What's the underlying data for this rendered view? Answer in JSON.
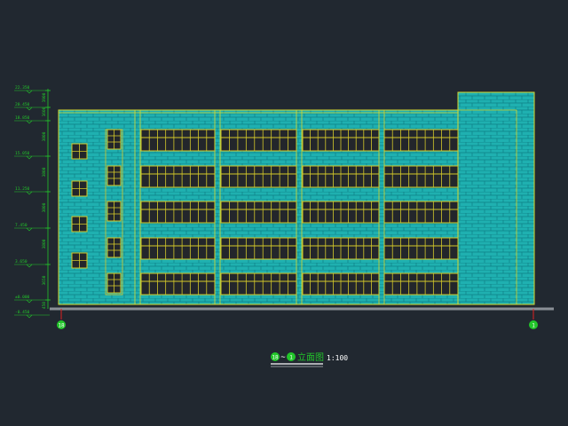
{
  "colors": {
    "background": "#212830",
    "wall": "#1fb0b0",
    "brick": "#0d7f86",
    "outline": "#d7d72e",
    "window_frame": "#d4c92a",
    "window_glass": "#23262b",
    "dimension": "#22c62a",
    "ground": "#8a8f96",
    "axis_bubble": "#22c62a",
    "axis_line": "#e02020"
  },
  "elevation_marks": [
    "22.350",
    "20.450",
    "18.850",
    "15.050",
    "11.250",
    "7.450",
    "3.650",
    "±0.000",
    "-0.450"
  ],
  "dimension_values": [
    "1900",
    "1600",
    "3800",
    "3800",
    "3800",
    "3800",
    "3650",
    "450"
  ],
  "axis_labels": {
    "left": "18",
    "right": "1"
  },
  "title": {
    "start_axis": "18",
    "connector": "~",
    "end_axis": "1",
    "name": "立面图",
    "scale": "1:100"
  }
}
